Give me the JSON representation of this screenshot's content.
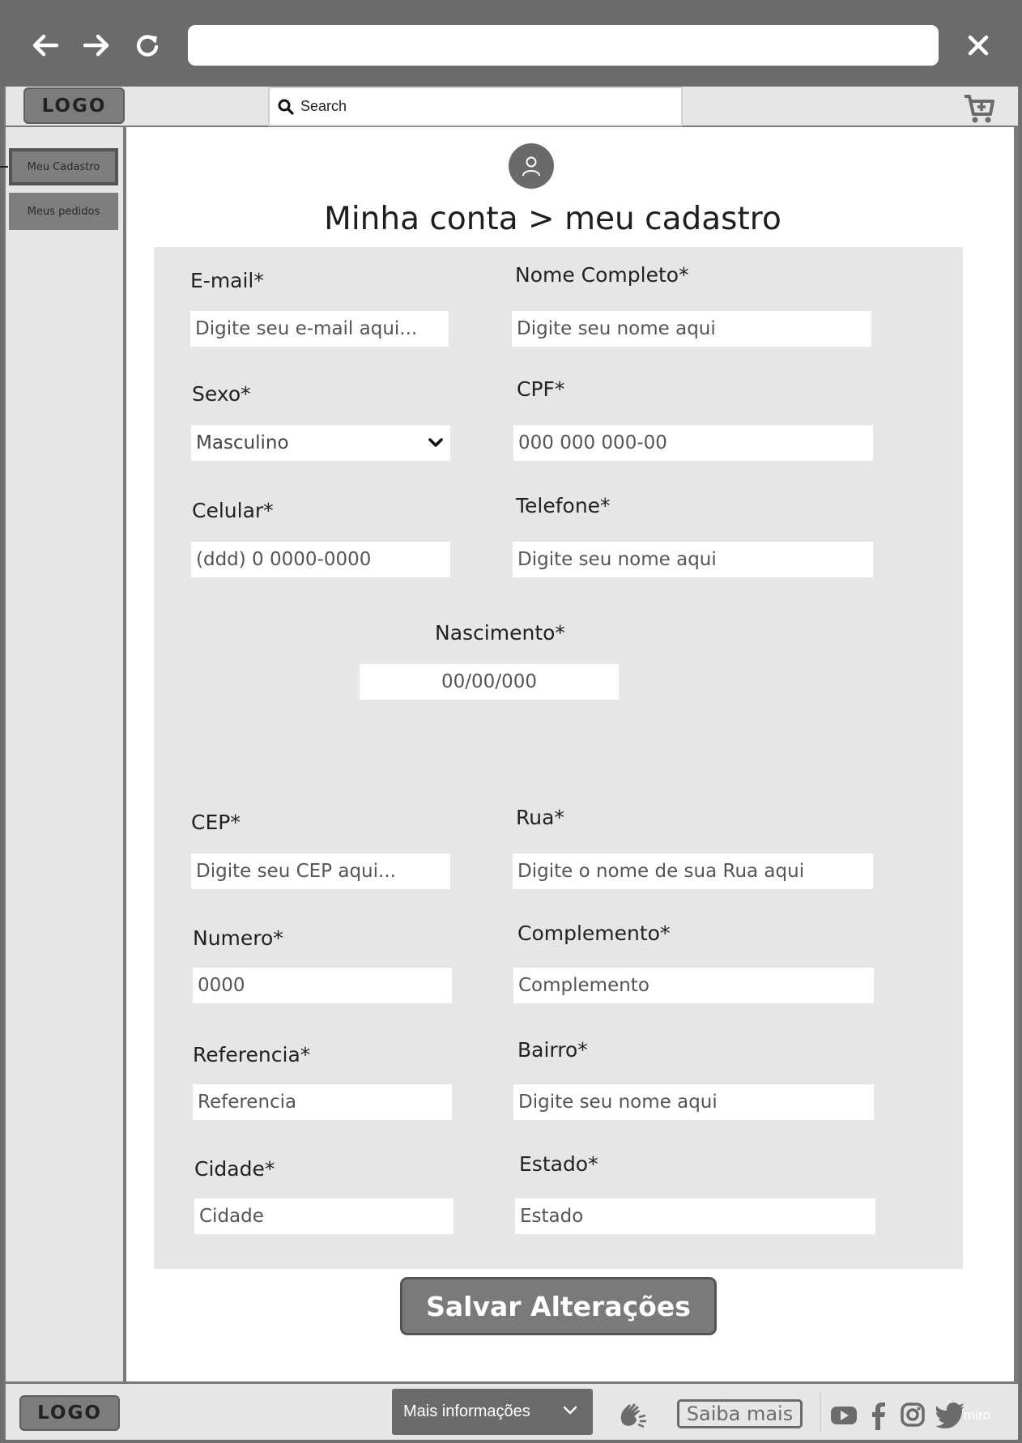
{
  "header": {
    "logo": "LOGO",
    "search_placeholder": "Search"
  },
  "sidebar": {
    "items": [
      {
        "label": "Meu Cadastro"
      },
      {
        "label": "Meus pedidos"
      }
    ]
  },
  "page": {
    "title": "Minha conta > meu cadastro"
  },
  "form": {
    "email": {
      "label": "E-mail*",
      "placeholder": "Digite seu e-mail aqui..."
    },
    "nome": {
      "label": "Nome Completo*",
      "placeholder": "Digite seu nome aqui"
    },
    "sexo": {
      "label": "Sexo*",
      "value": "Masculino"
    },
    "cpf": {
      "label": "CPF*",
      "placeholder": "000 000 000-00"
    },
    "celular": {
      "label": "Celular*",
      "placeholder": "(ddd) 0 0000-0000"
    },
    "telefone": {
      "label": "Telefone*",
      "placeholder": "Digite seu nome aqui"
    },
    "nascimento": {
      "label": "Nascimento*",
      "placeholder": "00/00/000"
    },
    "cep": {
      "label": "CEP*",
      "placeholder": "Digite seu CEP aqui..."
    },
    "rua": {
      "label": "Rua*",
      "placeholder": "Digite o nome de sua Rua aqui"
    },
    "numero": {
      "label": "Numero*",
      "placeholder": "0000"
    },
    "complemento": {
      "label": "Complemento*",
      "placeholder": "Complemento"
    },
    "referencia": {
      "label": "Referencia*",
      "placeholder": "Referencia"
    },
    "bairro": {
      "label": "Bairro*",
      "placeholder": "Digite seu nome aqui"
    },
    "cidade": {
      "label": "Cidade*",
      "placeholder": "Cidade"
    },
    "estado": {
      "label": "Estado*",
      "placeholder": "Estado"
    },
    "save_label": "Salvar Alterações"
  },
  "footer": {
    "logo": "LOGO",
    "more_label": "Mais informações",
    "saiba_label": "Saiba mais",
    "watermark": "miro"
  },
  "colors": {
    "chrome": "#6b6b6b",
    "panel": "#e6e6e6",
    "button": "#7a7a7a"
  }
}
